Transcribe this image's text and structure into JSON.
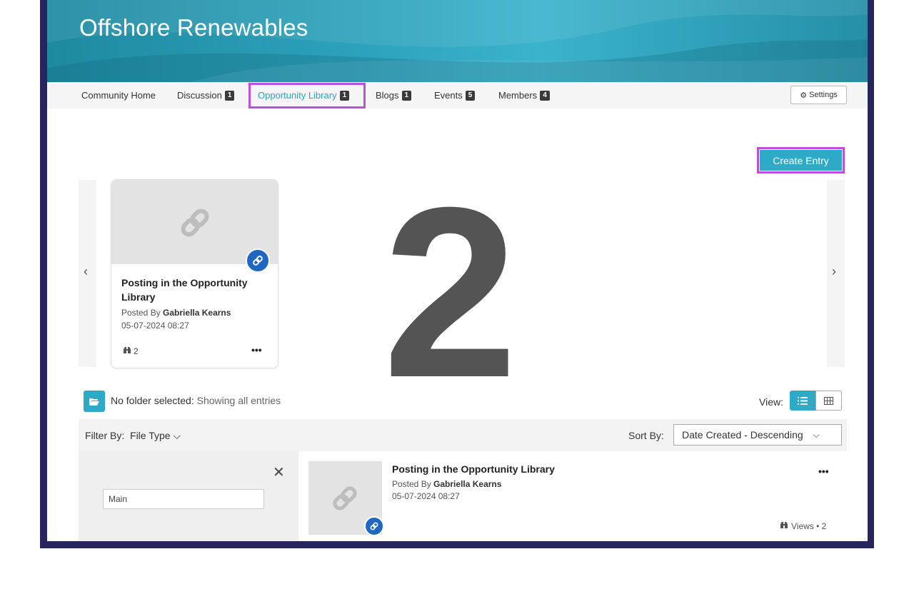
{
  "banner": {
    "title": "Offshore Renewables"
  },
  "nav": {
    "items": [
      {
        "label": "Community Home",
        "count": ""
      },
      {
        "label": "Discussion",
        "count": "1"
      },
      {
        "label": "Opportunity Library",
        "count": "1"
      },
      {
        "label": "Blogs",
        "count": "1"
      },
      {
        "label": "Events",
        "count": "5"
      },
      {
        "label": "Members",
        "count": "4"
      }
    ],
    "active_index": 2,
    "settings_label": "Settings"
  },
  "actions": {
    "create_entry_label": "Create Entry"
  },
  "overlay": {
    "step_number": "2"
  },
  "carousel": {
    "card": {
      "title": "Posting in the Opportunity Library",
      "posted_by_prefix": "Posted By",
      "author": "Gabriella Kearns",
      "date": "05-07-2024 08:27",
      "views": "2",
      "more": "•••"
    }
  },
  "folder": {
    "status_label": "No folder selected:",
    "status_detail": "Showing all entries",
    "name_value": "Main"
  },
  "view": {
    "label": "View:"
  },
  "filter": {
    "filter_label": "Filter By:",
    "file_type_label": "File Type",
    "sort_label": "Sort By:",
    "sort_value": "Date Created - Descending"
  },
  "list": {
    "entry": {
      "title": "Posting in the Opportunity Library",
      "posted_by_prefix": "Posted By",
      "author": "Gabriella Kearns",
      "date": "05-07-2024 08:27",
      "views_label": "Views • 2",
      "more": "•••"
    }
  },
  "colors": {
    "accent": "#2eaac9",
    "highlight": "#c04ddf",
    "frame": "#27245e",
    "link_badge": "#1f67c1"
  }
}
